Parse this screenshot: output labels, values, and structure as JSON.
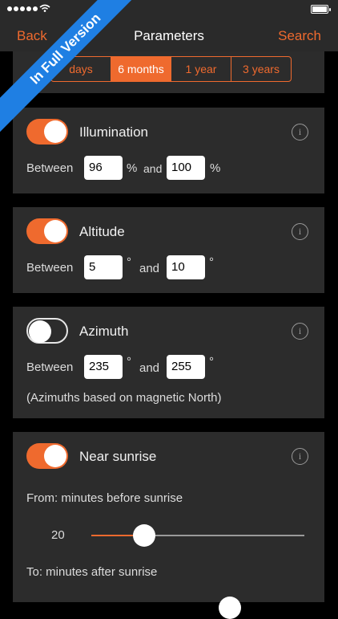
{
  "nav": {
    "back": "Back",
    "title": "Parameters",
    "search": "Search"
  },
  "segments": {
    "items": [
      "days",
      "6 months",
      "1 year",
      "3 years"
    ],
    "active": "6 months"
  },
  "ribbon": "In Full Version",
  "illumination": {
    "title": "Illumination",
    "between": "Between",
    "from": "96",
    "and": "and",
    "to": "100",
    "unit": "%"
  },
  "altitude": {
    "title": "Altitude",
    "between": "Between",
    "from": "5",
    "and": "and",
    "to": "10",
    "unit": "°"
  },
  "azimuth": {
    "title": "Azimuth",
    "between": "Between",
    "from": "235",
    "and": "and",
    "to": "255",
    "unit": "°",
    "note": "(Azimuths based on magnetic North)"
  },
  "sunrise": {
    "title": "Near sunrise",
    "from_label": "From: minutes before sunrise",
    "from_value": "20",
    "to_label": "To: minutes after sunrise"
  },
  "toggles": {
    "illumination": true,
    "altitude": true,
    "azimuth": false,
    "sunrise": true
  },
  "colors": {
    "accent": "#ef6a2e",
    "ribbon": "#1f7fe3",
    "card": "#2c2c2c"
  },
  "icons": [
    "info-icon",
    "wifi-icon",
    "battery-icon"
  ]
}
